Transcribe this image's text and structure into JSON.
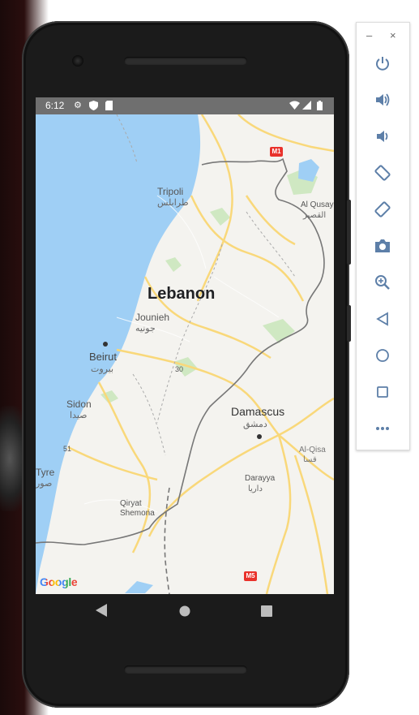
{
  "status_bar": {
    "time": "6:12"
  },
  "map": {
    "country": "Lebanon",
    "places": [
      {
        "name": "Tripoli",
        "name_ar": "طرابلس"
      },
      {
        "name": "Jounieh",
        "name_ar": "جونيه"
      },
      {
        "name": "Beirut",
        "name_ar": "بيروت"
      },
      {
        "name": "Sidon",
        "name_ar": "صيدا"
      },
      {
        "name": "Tyre",
        "name_ar": "صور"
      },
      {
        "name": "Qiryat Shemona"
      },
      {
        "name": "Al Qusayr",
        "name_ar": "القصير"
      },
      {
        "name": "Damascus",
        "name_ar": "دمشق"
      },
      {
        "name": "Al-Qisa",
        "name_ar": "قسا"
      },
      {
        "name": "Darayya",
        "name_ar": "داريا"
      }
    ],
    "road_shields": [
      "M1",
      "M5"
    ],
    "road_numbers": [
      "30",
      "51"
    ],
    "attribution": "Google",
    "colors": {
      "water": "#9fcff5",
      "land": "#f4f3ef",
      "road": "#f9d87a",
      "park": "#cfe8c2",
      "border": "#777777"
    }
  },
  "nav": {
    "back": "back",
    "home": "home",
    "recents": "recents"
  },
  "emulator_panel": {
    "window_controls": {
      "minimize": "–",
      "close": "×"
    },
    "buttons": [
      "power",
      "volume-up",
      "volume-down",
      "rotate-left",
      "rotate-right",
      "screenshot",
      "zoom",
      "back",
      "home",
      "overview",
      "more"
    ],
    "accent": "#5d7fa8"
  }
}
